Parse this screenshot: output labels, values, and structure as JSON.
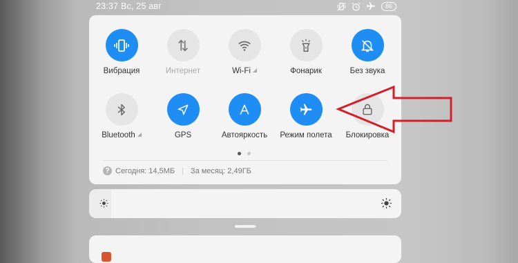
{
  "status_bar": {
    "time_date": "23:37 Вс, 25 авг",
    "battery": "86"
  },
  "quick_settings": {
    "row1": [
      {
        "label": "Вибрация",
        "state": "on",
        "icon": "vibrate-icon"
      },
      {
        "label": "Интернет",
        "state": "disabled",
        "icon": "mobile-data-icon"
      },
      {
        "label": "Wi-Fi",
        "state": "off",
        "icon": "wifi-icon"
      },
      {
        "label": "Фонарик",
        "state": "off",
        "icon": "flashlight-icon"
      },
      {
        "label": "Без звука",
        "state": "on",
        "icon": "bell-off-icon"
      }
    ],
    "row2": [
      {
        "label": "Bluetooth",
        "state": "off",
        "icon": "bluetooth-icon"
      },
      {
        "label": "GPS",
        "state": "on",
        "icon": "location-icon"
      },
      {
        "label": "Автояркость",
        "state": "on",
        "icon": "auto-brightness-icon"
      },
      {
        "label": "Режим полета",
        "state": "on",
        "icon": "airplane-icon"
      },
      {
        "label": "Блокировка",
        "state": "off",
        "icon": "lock-icon"
      }
    ],
    "page_index": 1,
    "page_count": 2
  },
  "data_usage": {
    "today": "Сегодня: 14,5МБ",
    "month": "За месяц: 2,49ГБ"
  },
  "brightness": {
    "level": 0.07
  },
  "colors": {
    "accent": "#1e8ef5",
    "annotation_arrow": "#d2202a"
  }
}
